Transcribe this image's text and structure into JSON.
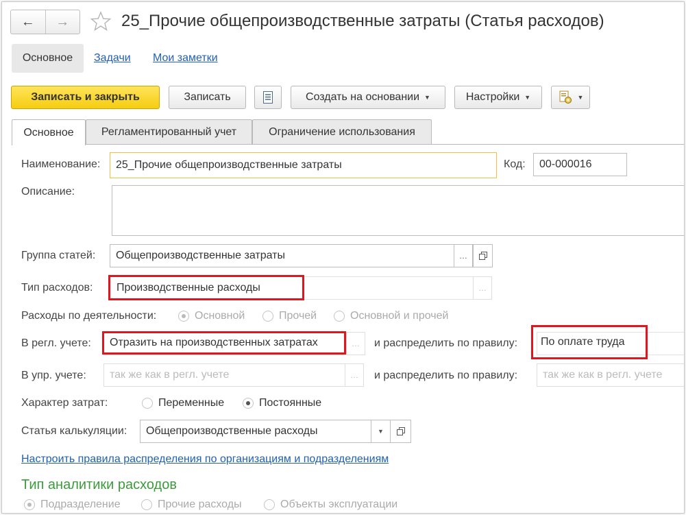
{
  "window": {
    "title": "25_Прочие общепроизводственные затраты (Статья расходов)"
  },
  "nav": {
    "back_glyph": "←",
    "forward_glyph": "→",
    "favorite_icon": "star-icon"
  },
  "top_tabs": {
    "main": "Основное",
    "tasks": "Задачи",
    "notes": "Мои заметки"
  },
  "toolbar": {
    "save_close": "Записать и закрыть",
    "save": "Записать",
    "create_based": "Создать на основании",
    "settings": "Настройки"
  },
  "tabs": [
    {
      "label": "Основное",
      "active": true
    },
    {
      "label": "Регламентированный учет",
      "active": false
    },
    {
      "label": "Ограничение использования",
      "active": false
    }
  ],
  "form": {
    "name_label": "Наименование:",
    "name_value": "25_Прочие общепроизводственные затраты",
    "code_label": "Код:",
    "code_value": "00-000016",
    "description_label": "Описание:",
    "description_value": "",
    "group_label": "Группа статей:",
    "group_value": "Общепроизводственные затраты",
    "expense_type_label": "Тип расходов:",
    "expense_type_value": "Производственные расходы",
    "activity_label": "Расходы по деятельности:",
    "activity_options": [
      "Основной",
      "Прочей",
      "Основной и прочей"
    ],
    "activity_selected": 0,
    "regl_label": "В регл. учете:",
    "regl_value": "Отразить на производственных затратах",
    "distribute_label": "и распределить по правилу:",
    "regl_rule_value": "По оплате труда",
    "upr_label": "В упр. учете:",
    "upr_placeholder": "так же как в регл. учете",
    "upr_rule_placeholder": "так же как в регл. учете",
    "character_label": "Характер затрат:",
    "character_options": [
      "Переменные",
      "Постоянные"
    ],
    "character_selected": 1,
    "calc_label": "Статья калькуляции:",
    "calc_value": "Общепроизводственные расходы",
    "rules_link": "Настроить правила распределения по организациям и подразделениям",
    "analytics_title": "Тип аналитики расходов",
    "analytics_options": [
      "Подразделение",
      "Прочие расходы",
      "Объекты эксплуатации"
    ],
    "analytics_selected": 0
  },
  "colors": {
    "primary_button": "#f5cd10",
    "highlight_box": "#e0161e",
    "link": "#2161b3",
    "section_title": "#3c9a3c"
  }
}
